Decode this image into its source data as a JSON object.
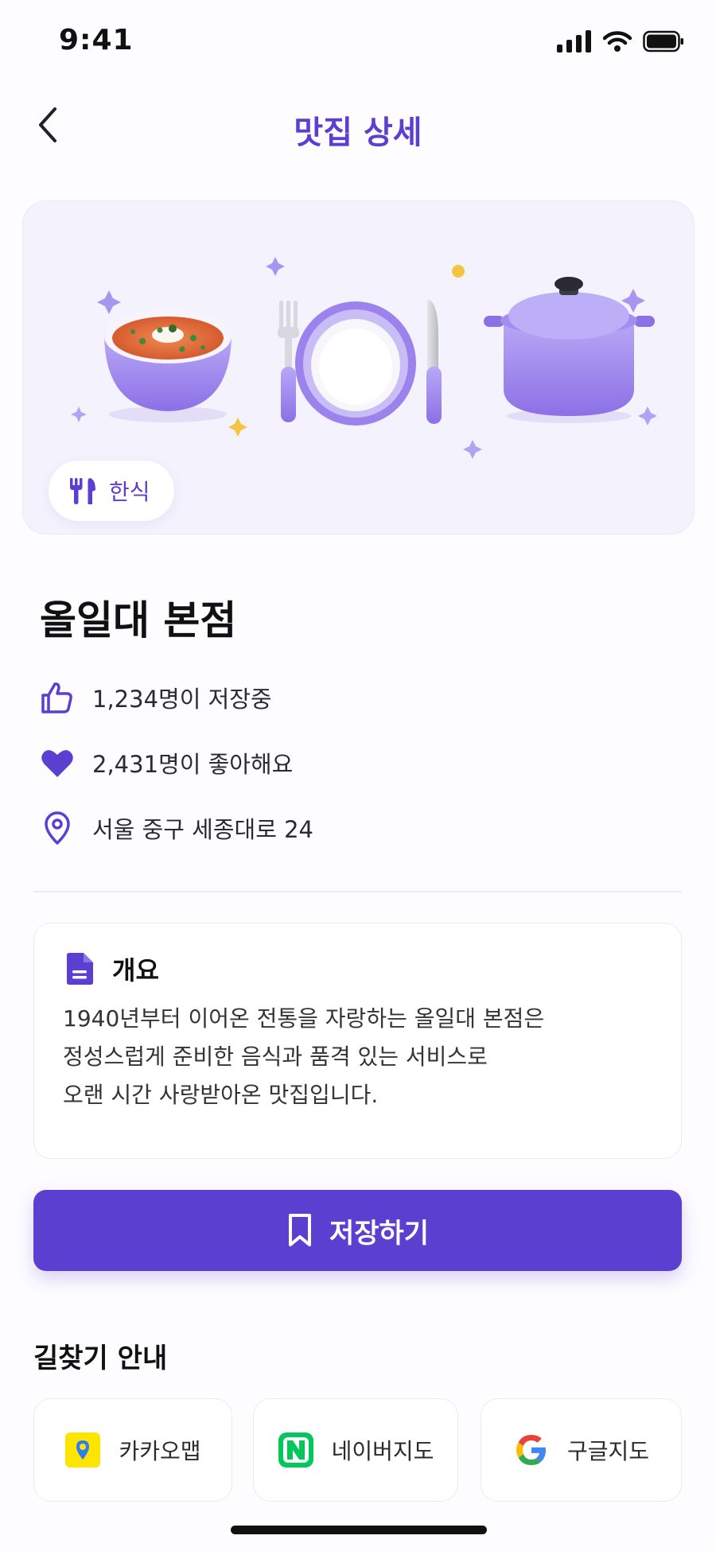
{
  "status_bar": {
    "time": "9:41"
  },
  "nav": {
    "title": "맛집 상세"
  },
  "hero": {
    "category": "한식"
  },
  "place": {
    "name": "올일대 본점",
    "saves_text": "1,234명이 저장중",
    "likes_text": "2,431명이 좋아해요",
    "address": "서울 중구 세종대로 24"
  },
  "overview": {
    "heading": "개요",
    "lines": [
      "1940년부터 이어온 전통을 자랑하는 올일대 본점은",
      "정성스럽게 준비한 음식과 품격 있는 서비스로",
      "오랜 시간 사랑받아온 맛집입니다."
    ]
  },
  "actions": {
    "save_label": "저장하기"
  },
  "directions": {
    "title": "길찾기 안내",
    "maps": [
      {
        "label": "카카오맵",
        "icon": "kakaomap-icon"
      },
      {
        "label": "네이버지도",
        "icon": "naver-map-icon"
      },
      {
        "label": "구글지도",
        "icon": "google-maps-icon"
      }
    ]
  },
  "colors": {
    "accent": "#5a3fd0",
    "hero_background": "#f4f2fd",
    "kakao_yellow": "#fee500",
    "naver_green": "#03c75a"
  }
}
